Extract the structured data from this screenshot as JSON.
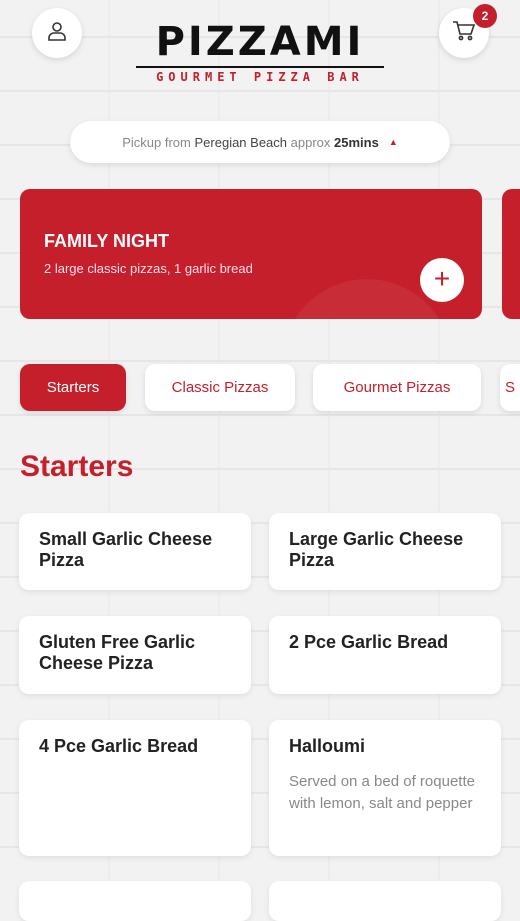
{
  "header": {
    "logo_title": "PIZZAMI",
    "logo_subtitle": "GOURMET PIZZA BAR",
    "cart_count": "2"
  },
  "pickup": {
    "prefix": "Pickup from",
    "location": "Peregian Beach",
    "approx": "approx",
    "time": "25mins"
  },
  "promo": {
    "title": "FAMILY NIGHT",
    "description": "2 large classic pizzas, 1 garlic bread",
    "add_symbol": "+"
  },
  "tabs": [
    {
      "label": "Starters",
      "active": true
    },
    {
      "label": "Classic Pizzas",
      "active": false
    },
    {
      "label": "Gourmet Pizzas",
      "active": false
    },
    {
      "label": "S",
      "active": false
    }
  ],
  "section": {
    "title": "Starters"
  },
  "items": [
    {
      "title": "Small Garlic Cheese Pizza",
      "description": ""
    },
    {
      "title": "Large Garlic Cheese Pizza",
      "description": ""
    },
    {
      "title": "Gluten Free Garlic Cheese Pizza",
      "description": ""
    },
    {
      "title": "2 Pce Garlic Bread",
      "description": ""
    },
    {
      "title": "4 Pce Garlic Bread",
      "description": ""
    },
    {
      "title": "Halloumi",
      "description": "Served on a bed of roquette with lemon, salt and pepper"
    }
  ],
  "colors": {
    "accent": "#c41f2b",
    "background": "#f2f2f2",
    "card": "#ffffff"
  },
  "icons": {
    "profile": "user-icon",
    "cart": "cart-icon",
    "dropdown": "caret-up-icon",
    "add": "plus-icon"
  }
}
